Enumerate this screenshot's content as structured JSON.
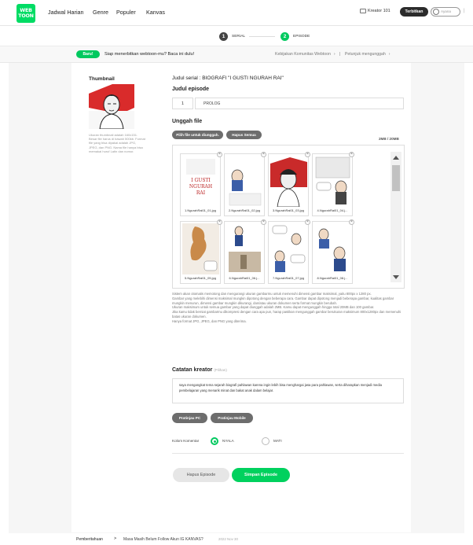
{
  "nav": {
    "logo_line1": "WEB",
    "logo_line2": "TOON",
    "links": [
      "Jadwal Harian",
      "Genre",
      "Populer",
      "Kanvas"
    ],
    "creator_label": "Kreator 101",
    "publish_label": "Terbitkan",
    "user_placeholder": "Ayana",
    "separator": "|"
  },
  "steps": {
    "step1": {
      "num": "1",
      "label": "SERIAL",
      "color": "#444444"
    },
    "step2": {
      "num": "2",
      "label": "EPISODE",
      "color": "#00c95f"
    }
  },
  "info": {
    "badge": "Baru!",
    "text": "Siap menerbitkan webtoon-mu? Baca ini dulu!",
    "link1": "Kebijakan Komunitas Webtoon",
    "link2": "Petunjuk mengunggah",
    "sep": "|",
    "chev": "›"
  },
  "thumbnail": {
    "title": "Thumbnail",
    "desc": "Ukuran thumbnail adalah 160x151. Besar file harus di bawah 500kb. Format file yang bisa dipakai adalah JPG, JPEG, dan PNG. Nama file hanya bisa memakai huruf Latin dan nomor."
  },
  "series": {
    "title": "Judul serial : BIOGRAFI \"I GUSTI NGURAH RAI\""
  },
  "episode": {
    "label": "Judul episode",
    "number": "1",
    "name": "PROLOG"
  },
  "upload": {
    "label": "Unggah file",
    "choose_btn": "Pilih file untuk diunggah.",
    "delete_all_btn": "Hapus Semua",
    "size": "2MB / 20MB",
    "files": [
      "1.NgurahRai01_01.jpg",
      "2.NgurahRai01_02.jpg",
      "3.NgurahRai01_03.jpg",
      "4.NgurahRai01_04.j...",
      "5.NgurahRai01_05.jpg",
      "6.NgurahRai01_06.j...",
      "7.NgurahRai01_07.jpg",
      "8.NgurahRai01_08.j..."
    ],
    "cover_text1": "I GUSTI",
    "cover_text2": "NGURAH",
    "cover_text3": "RAI",
    "close_glyph": "×"
  },
  "guide": [
    "Sistem akan otomatis memotong dan mengurangi ukuran gambarmu untuk memenuhi dimensi gambar maksimal, yaitu 800px x 1280 px.",
    "Gambar yang melebihi dimensi maksimal mungkin dipotong dengan beberapa cara. Gambar dapat dipotong menjadi beberapa gambar, kualitas gambar mungkin menurun, dimensi gambar mungkin dikurangi, dan/atau ukuran dokumen serta format mungkin berubah.",
    "Ukuran maksimum untuk semua gambar yang dapat diunggah adalah 2MB. Kamu dapat mengunggah hingga total 20MB dan 100 gambar.",
    "Jika kamu tidak berniat gambarmu dikompresi dengan cara apa pun, harap pastikan mengunggah gambar berukuran maksimum 800x1280px dan memenuhi batas ukuran dokumen.",
    "Hanya format JPG, JPEG, dan PNG yang diterima."
  ],
  "notes": {
    "label": "Catatan kreator",
    "optional": "(Pilihan)",
    "text": "saya mengangkat tema sejarah biografi pahlawan karena ingin lebih bisa menghargai jasa para pahlawan, serta diharapkan menjadi media pembelajaran yang menarik minat dan bakat anak dalam belajar."
  },
  "preview": {
    "pc": "Pratinjau PC",
    "mobile": "Pratinjau Mobile"
  },
  "comments": {
    "label": "Kolom Komentar",
    "on": "NYALA",
    "off": "MATI"
  },
  "actions": {
    "delete": "Hapus Episode",
    "save": "Simpan Episode"
  },
  "footer": {
    "label": "Pemberitahuan",
    "arrow": ">",
    "message": "Masa Masih Belum Follow Akun IG KANVAS?",
    "date": "2022 Nov 30"
  },
  "colors": {
    "brand": "#00dc64",
    "accent": "#00c95f",
    "dark": "#2b2b2b"
  }
}
